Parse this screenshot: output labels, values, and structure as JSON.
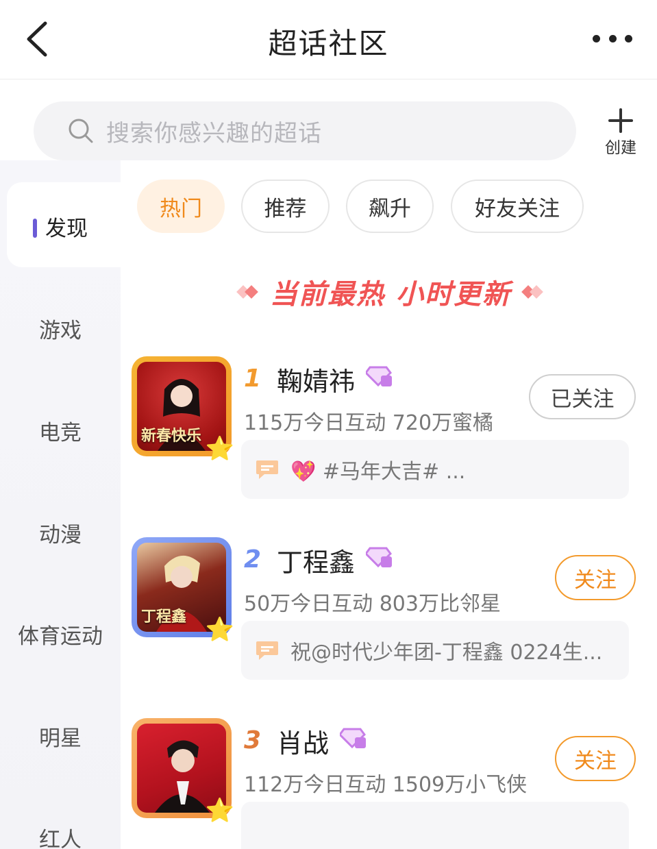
{
  "header": {
    "title": "超话社区",
    "back_icon": "chevron-left-icon",
    "more_icon": "more-dots-icon"
  },
  "search": {
    "placeholder": "搜索你感兴趣的超话",
    "icon": "search-icon"
  },
  "create": {
    "label": "创建",
    "icon": "plus-icon"
  },
  "sidebar": {
    "items": [
      {
        "label": "发现",
        "active": true
      },
      {
        "label": "游戏"
      },
      {
        "label": "电竞"
      },
      {
        "label": "动漫"
      },
      {
        "label": "体育运动"
      },
      {
        "label": "明星"
      },
      {
        "label": "红人"
      }
    ],
    "accent_color": "#6b5bd6"
  },
  "tabs": [
    {
      "label": "热门",
      "active": true
    },
    {
      "label": "推荐"
    },
    {
      "label": "飙升"
    },
    {
      "label": "好友关注"
    }
  ],
  "banner": {
    "text": "当前最热 小时更新",
    "color": "#f05454"
  },
  "list": [
    {
      "rank": "1",
      "name": "鞠婧祎",
      "stats": "115万今日互动 720万蜜橘",
      "follow_label": "已关注",
      "followed": true,
      "post_emoji": "💖",
      "post_text": "#马年大吉# ...",
      "avatar_caption": "新春快乐",
      "avatar_colors": [
        "#b51d1d",
        "#f2b328"
      ],
      "rank_color": "#f29a2e"
    },
    {
      "rank": "2",
      "name": "丁程鑫",
      "stats": "50万今日互动 803万比邻星",
      "follow_label": "关注",
      "followed": false,
      "post_emoji": "",
      "post_text": "祝@时代少年团-丁程鑫  0224生...",
      "avatar_caption": "丁程鑫",
      "avatar_colors": [
        "#7a1a1a",
        "#6f8ef0"
      ],
      "rank_color": "#6f8ef0"
    },
    {
      "rank": "3",
      "name": "肖战",
      "stats": "112万今日互动 1509万小飞侠",
      "follow_label": "关注",
      "followed": false,
      "post_emoji": "",
      "post_text": "",
      "avatar_caption": "",
      "avatar_colors": [
        "#c01e2a",
        "#f2a654"
      ],
      "rank_color": "#e07a3a"
    }
  ],
  "colors": {
    "accent_orange": "#f08a1c",
    "vip_purple": "#c77de8"
  }
}
